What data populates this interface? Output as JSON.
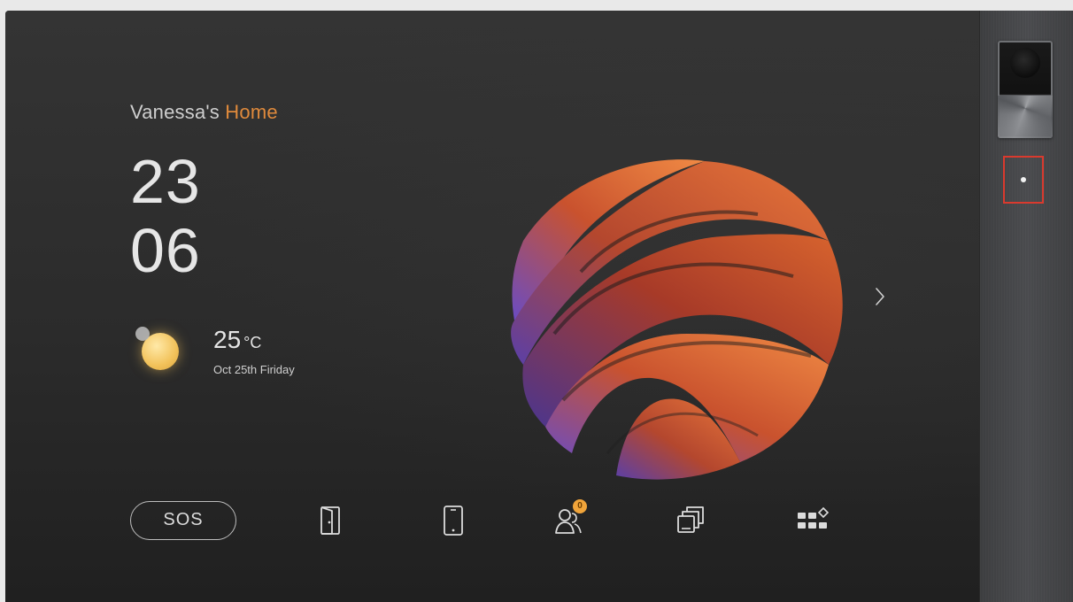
{
  "header": {
    "home_name_prefix": "Vanessa's ",
    "home_name_accent": "Home"
  },
  "clock": {
    "hours": "23",
    "minutes": "06"
  },
  "weather": {
    "icon": "sun-cloud-icon",
    "temperature": "25",
    "unit": "°C",
    "date": "Oct 25th Firiday"
  },
  "carousel": {
    "next_icon": "chevron-right-icon"
  },
  "dock": {
    "sos_label": "SOS",
    "items": [
      {
        "id": "door",
        "icon": "door-icon"
      },
      {
        "id": "mobile",
        "icon": "phone-icon"
      },
      {
        "id": "contacts",
        "icon": "contacts-icon",
        "badge": "0"
      },
      {
        "id": "records",
        "icon": "gallery-icon"
      },
      {
        "id": "apps",
        "icon": "apps-grid-icon"
      }
    ]
  },
  "hardware": {
    "camera": "camera-icon",
    "sensor": "sensor-dot"
  },
  "colors": {
    "accent": "#e08a3c",
    "badge": "#f0a43a",
    "highlight": "#d93a2e"
  }
}
